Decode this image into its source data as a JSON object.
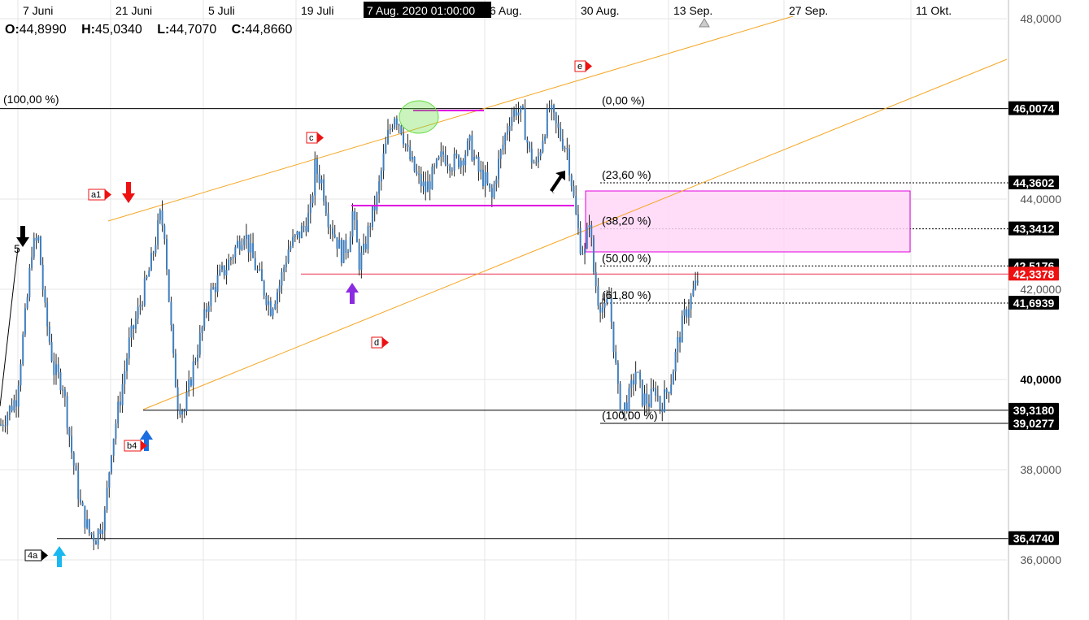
{
  "ohlc": {
    "o_label": "O:",
    "o": "44,8990",
    "h_label": "H:",
    "h": "45,0340",
    "l_label": "L:",
    "l": "44,7070",
    "c_label": "C:",
    "c": "44,8660"
  },
  "crosshair_label": "7 Aug. 2020 01:00:00",
  "colors": {
    "candle": "#3f7fbf",
    "channel": "#f5a623",
    "magenta": "#e000e0",
    "zone_fill": "#ffd6f7",
    "zone_stroke": "#e000e0",
    "red": "#ee1111",
    "redline": "#ee3355",
    "green": "#66dd44",
    "blue": "#1a6ee0",
    "cyan": "#1ab8f0",
    "purple": "#8a2be2"
  },
  "chart_data": {
    "type": "candlestick",
    "x_ticks": [
      "7 Juni",
      "21 Juni",
      "5 Juli",
      "19 Juli",
      "6 Aug.",
      "30 Aug.",
      "13 Sep.",
      "27 Sep.",
      "11 Okt."
    ],
    "y_ticks": [
      "48,0000",
      "44,0000",
      "42,0000",
      "40,0000",
      "38,0000",
      "36,0000"
    ],
    "ylim": [
      35.0,
      48.1
    ],
    "price_levels": [
      {
        "label": "46,0074",
        "value": 46.0074
      },
      {
        "label": "44,3602",
        "value": 44.3602
      },
      {
        "label": "43,3412",
        "value": 43.3412
      },
      {
        "label": "42,5176",
        "value": 42.5176
      },
      {
        "label": "42,3378",
        "value": 42.3378
      },
      {
        "label": "41,6939",
        "value": 41.6939
      },
      {
        "label": "39,3180",
        "value": 39.318
      },
      {
        "label": "39,0277",
        "value": 39.0277
      },
      {
        "label": "36,4740",
        "value": 36.474
      }
    ],
    "fib_labels": [
      {
        "label": "(0,00 %)",
        "value": 46.0074
      },
      {
        "label": "(23,60 %)",
        "value": 44.3602
      },
      {
        "label": "(38,20 %)",
        "value": 43.3412
      },
      {
        "label": "(50,00 %)",
        "value": 42.5176
      },
      {
        "label": "(61,80 %)",
        "value": 41.6939
      },
      {
        "label": "(100,00 %)",
        "value": 39.0277
      }
    ],
    "left_level_label": "(100,00 %)",
    "wave_labels": [
      "a1",
      "c",
      "e",
      "d",
      "b4",
      "4a"
    ],
    "top_number": "5",
    "path": [
      [
        0,
        39.0
      ],
      [
        7,
        39.6
      ],
      [
        12,
        41.8
      ],
      [
        14,
        42.9
      ],
      [
        17,
        43.1
      ],
      [
        20,
        41.5
      ],
      [
        24,
        40.2
      ],
      [
        28,
        39.9
      ],
      [
        32,
        38.4
      ],
      [
        36,
        37.2
      ],
      [
        40,
        36.6
      ],
      [
        43,
        36.5
      ],
      [
        47,
        37.0
      ],
      [
        50,
        38.5
      ],
      [
        54,
        39.6
      ],
      [
        58,
        40.8
      ],
      [
        62,
        41.5
      ],
      [
        66,
        42.2
      ],
      [
        68,
        42.6
      ],
      [
        72,
        43.6
      ],
      [
        74,
        43.3
      ],
      [
        76,
        41.8
      ],
      [
        78,
        40.4
      ],
      [
        80,
        39.5
      ],
      [
        83,
        39.3
      ],
      [
        87,
        40.3
      ],
      [
        90,
        40.9
      ],
      [
        94,
        41.8
      ],
      [
        98,
        42.2
      ],
      [
        102,
        42.5
      ],
      [
        106,
        42.9
      ],
      [
        110,
        43.3
      ],
      [
        113,
        42.8
      ],
      [
        118,
        42.1
      ],
      [
        122,
        41.6
      ],
      [
        126,
        42.1
      ],
      [
        130,
        42.9
      ],
      [
        133,
        43.1
      ],
      [
        136,
        43.3
      ],
      [
        140,
        43.7
      ],
      [
        142,
        44.7
      ],
      [
        145,
        44.4
      ],
      [
        148,
        43.6
      ],
      [
        151,
        43.2
      ],
      [
        154,
        42.8
      ],
      [
        157,
        43.0
      ],
      [
        159,
        43.7
      ],
      [
        162,
        42.6
      ],
      [
        164,
        42.8
      ],
      [
        167,
        43.5
      ],
      [
        170,
        44.0
      ],
      [
        173,
        44.9
      ],
      [
        175,
        45.4
      ],
      [
        178,
        45.9
      ],
      [
        181,
        45.6
      ],
      [
        184,
        45.0
      ],
      [
        188,
        44.5
      ],
      [
        192,
        44.2
      ],
      [
        196,
        44.6
      ],
      [
        200,
        45.0
      ],
      [
        204,
        44.8
      ],
      [
        208,
        44.9
      ],
      [
        212,
        45.2
      ],
      [
        216,
        44.6
      ],
      [
        219,
        44.4
      ],
      [
        222,
        44.0
      ],
      [
        224,
        44.6
      ],
      [
        227,
        45.2
      ],
      [
        230,
        45.8
      ],
      [
        233,
        46.0
      ],
      [
        236,
        45.8
      ],
      [
        239,
        45.0
      ],
      [
        242,
        44.7
      ],
      [
        245,
        45.4
      ],
      [
        248,
        46.0
      ],
      [
        251,
        45.6
      ],
      [
        254,
        45.3
      ],
      [
        256,
        45.1
      ],
      [
        258,
        44.4
      ],
      [
        260,
        43.6
      ],
      [
        262,
        43.0
      ],
      [
        264,
        42.8
      ],
      [
        266,
        43.6
      ],
      [
        268,
        42.4
      ],
      [
        270,
        41.8
      ],
      [
        273,
        41.5
      ],
      [
        275,
        41.8
      ],
      [
        277,
        40.8
      ],
      [
        279,
        39.7
      ],
      [
        281,
        39.3
      ],
      [
        284,
        39.6
      ],
      [
        287,
        40.2
      ],
      [
        290,
        39.6
      ],
      [
        293,
        39.5
      ],
      [
        296,
        39.8
      ],
      [
        298,
        39.4
      ],
      [
        300,
        39.6
      ],
      [
        303,
        40.0
      ],
      [
        306,
        40.8
      ],
      [
        309,
        41.4
      ],
      [
        312,
        41.8
      ],
      [
        315,
        42.2
      ],
      [
        316,
        43.2
      ]
    ]
  }
}
